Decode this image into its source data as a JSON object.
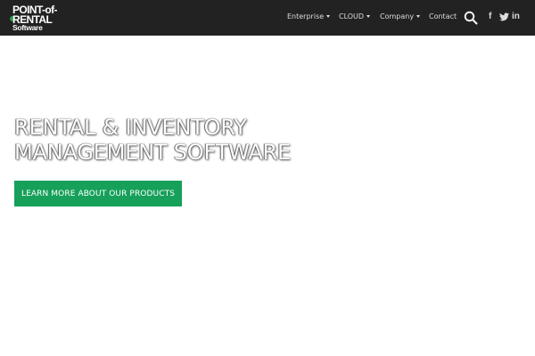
{
  "logo": {
    "line1": "POINT-of-",
    "line2": "RENTAL",
    "line3": "Software"
  },
  "nav": {
    "items": [
      {
        "label": "Enterprise",
        "dropdown": true
      },
      {
        "label": "CLOUD",
        "dropdown": true
      },
      {
        "label": "Company",
        "dropdown": true
      },
      {
        "label": "Contact",
        "dropdown": false
      }
    ],
    "icons": [
      "search-icon",
      "facebook-icon",
      "twitter-icon",
      "linkedin-icon"
    ]
  },
  "hero": {
    "title_line1": "RENTAL & INVENTORY",
    "title_line2": "MANAGEMENT SOFTWARE",
    "cta_label": "LEARN MORE ABOUT OUR PRODUCTS"
  },
  "colors": {
    "navbar_bg": "#222222",
    "accent_green": "#16a05a",
    "page_bg": "#ffffff"
  }
}
